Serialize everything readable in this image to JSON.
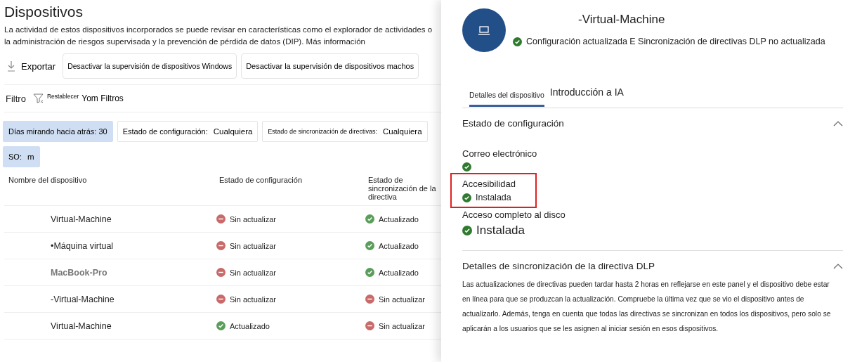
{
  "page": {
    "title": "Dispositivos",
    "description": "La actividad de estos dispositivos incorporados se puede revisar en características como el explorador de actividades o la administración de riesgos supervisada y la prevención de pérdida de datos (DIP).",
    "more_link": "Más información"
  },
  "toolbar": {
    "export": "Exportar",
    "buttons": [
      "Desactivar la supervisión de dispositivos Windows",
      "Desactivar la supervisión de dispositivos machos"
    ]
  },
  "filter_bar": {
    "label": "Filtro",
    "reset_small": "Restablecer",
    "reset": "Yom Filtros"
  },
  "filters": [
    {
      "label": "Días mirando hacia atrás: 30",
      "selected": true
    },
    {
      "label": "Estado de configuración:",
      "value": "Cualquiera",
      "selected": false
    },
    {
      "label": "Estado de sincronización de directivas:",
      "value": "Cualquiera",
      "selected": false,
      "kind": "tiny"
    },
    {
      "label": "SO:",
      "value": "m",
      "selected": true
    }
  ],
  "table": {
    "columns": [
      "Nombre del dispositivo",
      "Estado de configuración",
      "Estado de sincronización de la directiva"
    ],
    "rows": [
      {
        "name": "Virtual-Machine",
        "greyed": false,
        "config": {
          "text": "Sin actualizar",
          "updated": false
        },
        "sync": {
          "text": "Actualizado",
          "updated": true
        }
      },
      {
        "name": "•Máquina virtual",
        "greyed": false,
        "config": {
          "text": "Sin actualizar",
          "updated": false
        },
        "sync": {
          "text": "Actualizado",
          "updated": true
        }
      },
      {
        "name": "MacBook-Pro",
        "greyed": true,
        "config": {
          "text": "Sin actualizar",
          "updated": false
        },
        "sync": {
          "text": "Actualizado",
          "updated": true
        }
      },
      {
        "name": "-Virtual-Machine",
        "greyed": false,
        "config": {
          "text": "Sin actualizar",
          "updated": false
        },
        "sync": {
          "text": "Sin actualizar",
          "updated": false
        }
      },
      {
        "name": "Virtual-Machine",
        "greyed": false,
        "config": {
          "text": "Actualizado",
          "updated": true
        },
        "sync": {
          "text": "Sin actualizar",
          "updated": false
        }
      }
    ]
  },
  "panel": {
    "device_name": "-Virtual-Machine",
    "summary": {
      "ok": true,
      "text": "Configuración actualizada E Sincronización de directivas DLP no actualizada"
    },
    "tabs": [
      {
        "label": "Detalles del dispositivo",
        "selected": true
      },
      {
        "label": "Introducción a IA",
        "selected": false
      }
    ],
    "sections": [
      {
        "title": "Estado de configuración",
        "expanded": true,
        "items": [
          {
            "label": "Correo electrónico",
            "ok": true,
            "highlighted": false
          },
          {
            "label": "Accesibilidad",
            "value": "Instalada",
            "ok": true,
            "highlighted": true
          },
          {
            "label": "Acceso completo al disco",
            "value": "Instalada",
            "ok": true,
            "highlighted": false,
            "kind": "large"
          }
        ]
      },
      {
        "title": "Detalles de sincronización de la directiva DLP",
        "expanded": true,
        "paragraph": "Las actualizaciones de directivas pueden tardar hasta 2 horas en reflejarse en este panel y el dispositivo debe estar en línea para que se produzcan la actualización. Compruebe la última vez que se vio el dispositivo antes de actualizarlo. Además, tenga en cuenta que todas las directivas se sincronizan en todos los dispositivos, pero solo se aplicarán a los usuarios que se les asignen al iniciar sesión en esos dispositivos."
      }
    ]
  }
}
